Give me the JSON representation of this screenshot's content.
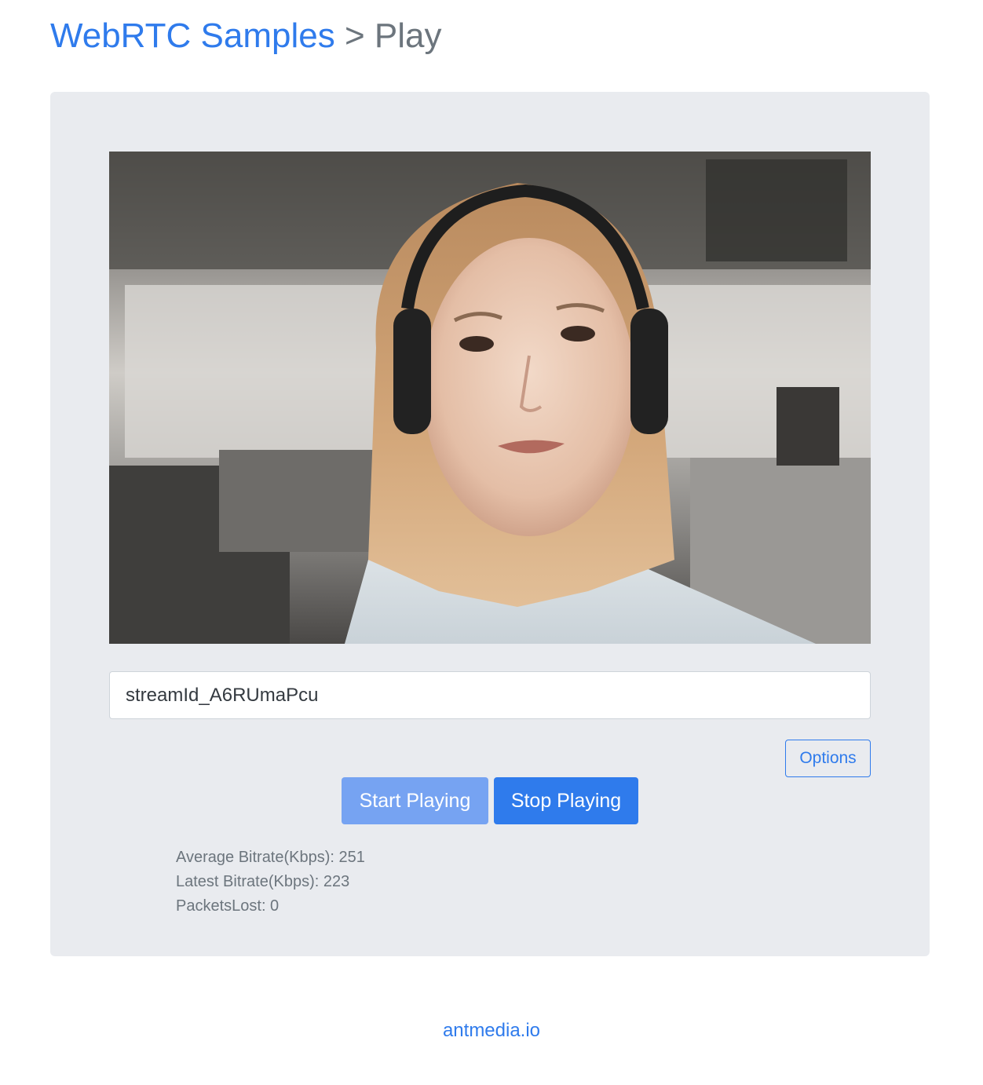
{
  "header": {
    "link_text": "WebRTC Samples",
    "separator": " > ",
    "page": "Play"
  },
  "video": {
    "icon": "video-frame"
  },
  "stream": {
    "value": "streamId_A6RUmaPcu"
  },
  "options_label": "Options",
  "controls": {
    "start_label": "Start Playing",
    "stop_label": "Stop Playing"
  },
  "stats": {
    "average": "Average Bitrate(Kbps): 251",
    "latest": "Latest Bitrate(Kbps): 223",
    "packets": "PacketsLost: 0"
  },
  "footer": {
    "link_text": "antmedia.io"
  },
  "colors": {
    "accent": "#2f7bec",
    "accent_disabled": "#76a3f2",
    "panel_bg": "#e9ebef",
    "muted_text": "#6c757d"
  }
}
